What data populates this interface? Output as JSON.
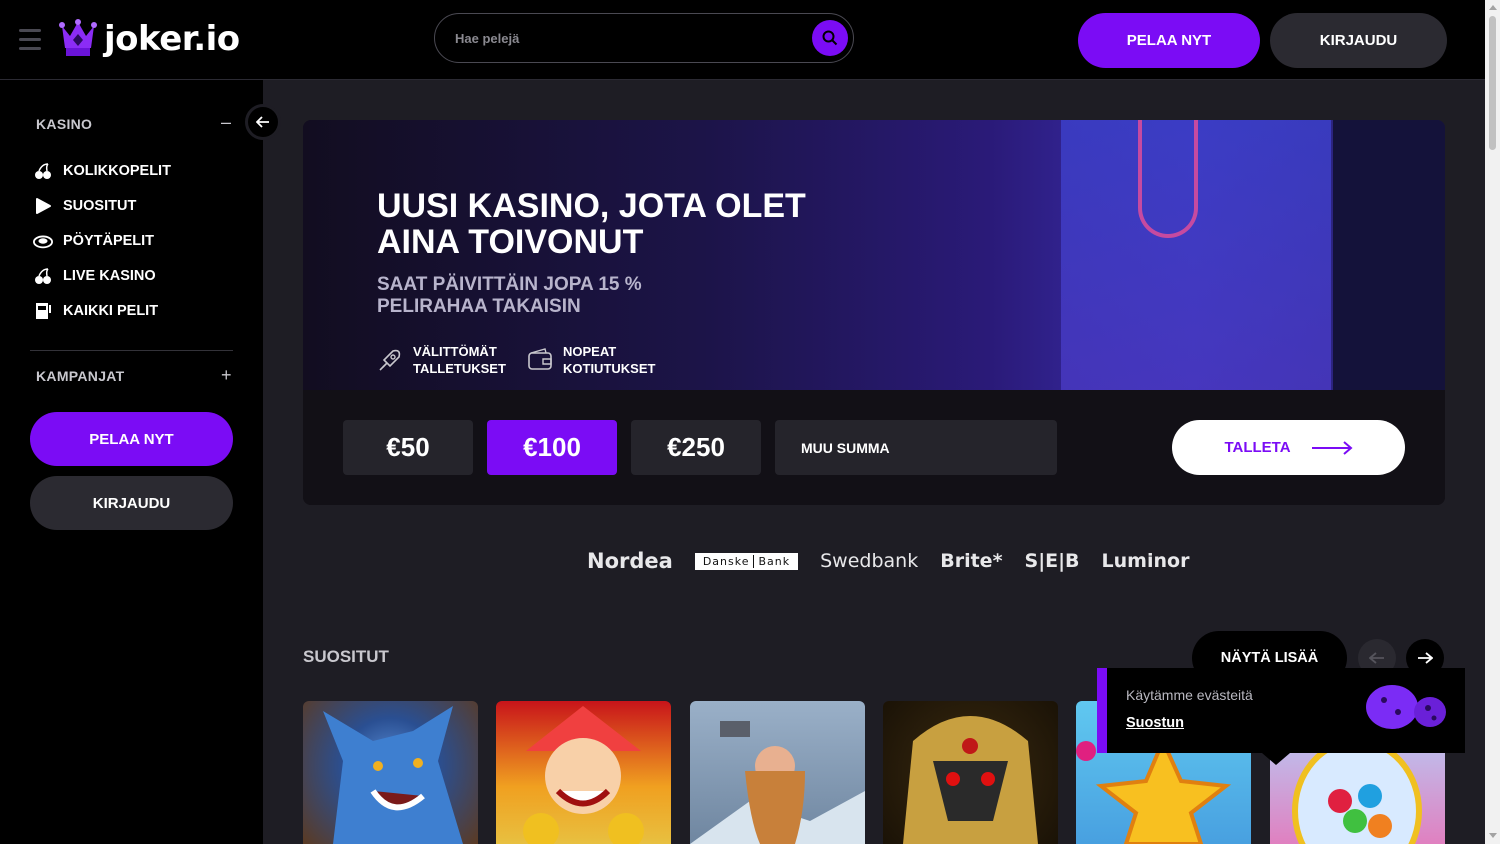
{
  "header": {
    "logo_text": "joker.io",
    "search_placeholder": "Hae pelejä",
    "play_button": "PELAA NYT",
    "login_button": "KIRJAUDU"
  },
  "sidebar": {
    "casino_label": "KASINO",
    "casino_toggle": "–",
    "items": [
      {
        "label": "KOLIKKOPELIT",
        "icon": "cherries-icon"
      },
      {
        "label": "SUOSITUT",
        "icon": "play-icon"
      },
      {
        "label": "PÖYTÄPELIT",
        "icon": "roulette-icon"
      },
      {
        "label": "LIVE KASINO",
        "icon": "cherries-icon"
      },
      {
        "label": "KAIKKI PELIT",
        "icon": "slot-machine-icon"
      }
    ],
    "campaigns_label": "KAMPANJAT",
    "campaigns_toggle": "+",
    "play_button": "PELAA NYT",
    "login_button": "KIRJAUDU"
  },
  "hero": {
    "title": "UUSI KASINO, JOTA OLET AINA TOIVONUT",
    "subtitle": "SAAT PÄIVITTÄIN JOPA 15 % PELIRAHAA TAKAISIN",
    "features": [
      {
        "line1": "VÄLITTÖMÄT",
        "line2": "TALLETUKSET",
        "icon": "rocket-icon"
      },
      {
        "line1": "NOPEAT",
        "line2": "KOTIUTUKSET",
        "icon": "wallet-icon"
      }
    ],
    "amounts": [
      "€50",
      "€100",
      "€250"
    ],
    "selected_amount": "€100",
    "custom_amount": "MUU SUMMA",
    "deposit_button": "TALLETA"
  },
  "banks": {
    "nordea": "Nordea",
    "danske_1": "Danske",
    "danske_2": "Bank",
    "swedbank": "Swedbank",
    "brite": "Brite*",
    "seb": "S|E|B",
    "luminor": "Luminor"
  },
  "popular": {
    "title": "SUOSITUT",
    "show_more": "NÄYTÄ LISÄÄ"
  },
  "cookie": {
    "text": "Käytämme evästeitä",
    "accept": "Suostun"
  },
  "colors": {
    "accent": "#7b0cf5",
    "background": "#1e1d24",
    "sidebar": "#000000"
  }
}
